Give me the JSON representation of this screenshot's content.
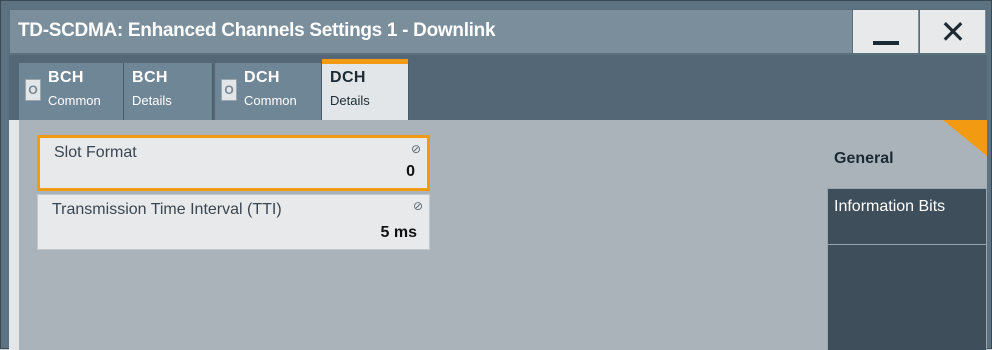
{
  "window": {
    "title": "TD-SCDMA: Enhanced Channels Settings 1 - Downlink",
    "minimize_icon": "minimize-icon",
    "close_icon": "close-icon",
    "close_glyph": "✕"
  },
  "tabs": [
    {
      "line1": "BCH",
      "line2": "Common",
      "led": "O",
      "active": false
    },
    {
      "line1": "BCH",
      "line2": "Details",
      "active": false
    },
    {
      "line1": "DCH",
      "line2": "Common",
      "led": "O",
      "active": false
    },
    {
      "line1": "DCH",
      "line2": "Details",
      "active": true
    }
  ],
  "fields": {
    "slot_format": {
      "label": "Slot Format",
      "value": "0",
      "icon": "⊘"
    },
    "tti": {
      "label": "Transmission Time Interval (TTI)",
      "value": "5 ms",
      "icon": "⊘"
    }
  },
  "side_nav": {
    "general": "General",
    "information_bits": "Information Bits"
  },
  "colors": {
    "accent": "#f29a12",
    "titlebar": "#7a8e9c",
    "panel_dark": "#3e4f5b"
  }
}
